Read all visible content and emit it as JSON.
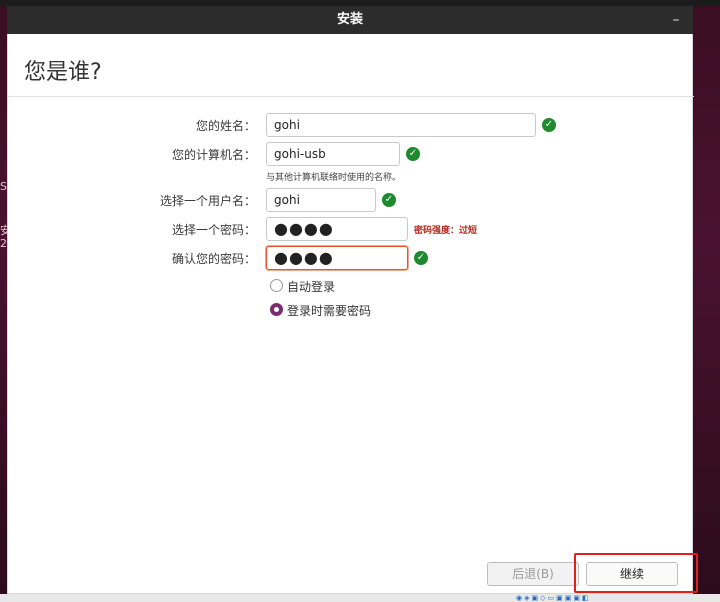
{
  "window": {
    "title": "安装",
    "minimize_glyph": "–"
  },
  "page": {
    "title": "您是谁?"
  },
  "form": {
    "name": {
      "label": "您的姓名：",
      "value": "gohi"
    },
    "computer": {
      "label": "您的计算机名：",
      "value": "gohi-usb",
      "hint": "与其他计算机联络时使用的名称。"
    },
    "username": {
      "label": "选择一个用户名：",
      "value": "gohi"
    },
    "password": {
      "label": "选择一个密码：",
      "value": "●●●●",
      "strength": "密码强度：过短"
    },
    "confirm": {
      "label": "确认您的密码：",
      "value": "●●●●"
    }
  },
  "login_options": [
    {
      "label": "自动登录",
      "selected": false
    },
    {
      "label": "登录时需要密码",
      "selected": true
    }
  ],
  "buttons": {
    "back": "后退(B)",
    "continue": "继续"
  },
  "icons": {
    "valid": "check-circle-icon"
  },
  "colors": {
    "valid": "#1d8a2e",
    "error": "#b3261e",
    "accent": "#7a2c6f",
    "highlight": "#e0201d"
  }
}
